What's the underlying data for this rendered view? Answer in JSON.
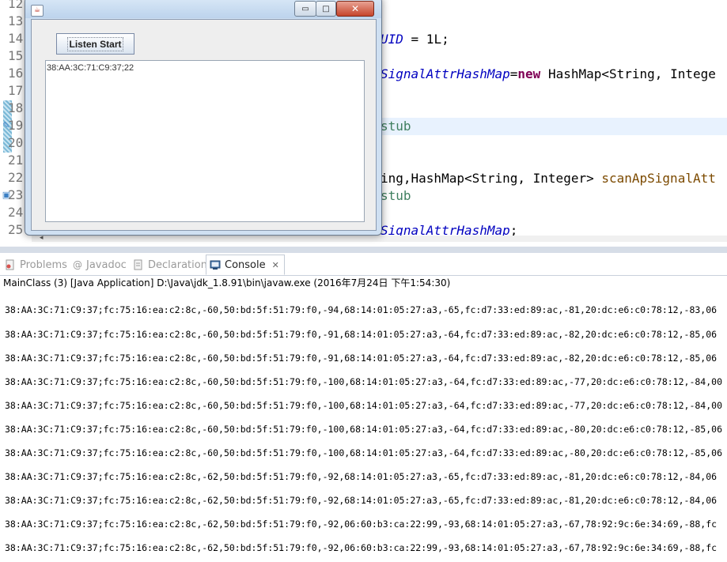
{
  "editor": {
    "line_numbers": [
      "12",
      "13",
      "14",
      "15",
      "16",
      "17",
      "18",
      "19",
      "20",
      "21",
      "22",
      "23",
      "24",
      "25"
    ],
    "code": {
      "line14_fld": "UID",
      "line14_rest": " = 1L;",
      "line16_fld": "SignalAttrHashMap",
      "line16_eq": "=",
      "line16_kw": "new",
      "line16_rest": " HashMap<String, Intege",
      "line19_cmt": "stub",
      "line22_a": "ing,HashMap<String, Integer> ",
      "line22_mth": "scanApSignalAtt",
      "line23_cmt": "stub",
      "line25_fld": "SignalAttrHashMap",
      "line25_rest": ";"
    }
  },
  "tabs": [
    {
      "label": "Problems",
      "icon": "problems-icon"
    },
    {
      "label": "Javadoc",
      "icon": "at-icon"
    },
    {
      "label": "Declaration",
      "icon": "declaration-icon"
    },
    {
      "label": "Console",
      "icon": "console-icon",
      "active": true
    }
  ],
  "console": {
    "header": "MainClass (3) [Java Application] D:\\Java\\jdk_1.8.91\\bin\\javaw.exe (2016年7月24日 下午1:54:30)",
    "lines": [
      "38:AA:3C:71:C9:37;fc:75:16:ea:c2:8c,-60,50:bd:5f:51:79:f0,-94,68:14:01:05:27:a3,-65,fc:d7:33:ed:89:ac,-81,20:dc:e6:c0:78:12,-83,06",
      "38:AA:3C:71:C9:37;fc:75:16:ea:c2:8c,-60,50:bd:5f:51:79:f0,-91,68:14:01:05:27:a3,-64,fc:d7:33:ed:89:ac,-82,20:dc:e6:c0:78:12,-85,06",
      "38:AA:3C:71:C9:37;fc:75:16:ea:c2:8c,-60,50:bd:5f:51:79:f0,-91,68:14:01:05:27:a3,-64,fc:d7:33:ed:89:ac,-82,20:dc:e6:c0:78:12,-85,06",
      "38:AA:3C:71:C9:37;fc:75:16:ea:c2:8c,-60,50:bd:5f:51:79:f0,-100,68:14:01:05:27:a3,-64,fc:d7:33:ed:89:ac,-77,20:dc:e6:c0:78:12,-84,00",
      "38:AA:3C:71:C9:37;fc:75:16:ea:c2:8c,-60,50:bd:5f:51:79:f0,-100,68:14:01:05:27:a3,-64,fc:d7:33:ed:89:ac,-77,20:dc:e6:c0:78:12,-84,00",
      "38:AA:3C:71:C9:37;fc:75:16:ea:c2:8c,-60,50:bd:5f:51:79:f0,-100,68:14:01:05:27:a3,-64,fc:d7:33:ed:89:ac,-80,20:dc:e6:c0:78:12,-85,06",
      "38:AA:3C:71:C9:37;fc:75:16:ea:c2:8c,-60,50:bd:5f:51:79:f0,-100,68:14:01:05:27:a3,-64,fc:d7:33:ed:89:ac,-80,20:dc:e6:c0:78:12,-85,06",
      "38:AA:3C:71:C9:37;fc:75:16:ea:c2:8c,-62,50:bd:5f:51:79:f0,-92,68:14:01:05:27:a3,-65,fc:d7:33:ed:89:ac,-81,20:dc:e6:c0:78:12,-84,06",
      "38:AA:3C:71:C9:37;fc:75:16:ea:c2:8c,-62,50:bd:5f:51:79:f0,-92,68:14:01:05:27:a3,-65,fc:d7:33:ed:89:ac,-81,20:dc:e6:c0:78:12,-84,06",
      "38:AA:3C:71:C9:37;fc:75:16:ea:c2:8c,-62,50:bd:5f:51:79:f0,-92,06:60:b3:ca:22:99,-93,68:14:01:05:27:a3,-67,78:92:9c:6e:34:69,-88,fc",
      "38:AA:3C:71:C9:37;fc:75:16:ea:c2:8c,-62,50:bd:5f:51:79:f0,-92,06:60:b3:ca:22:99,-93,68:14:01:05:27:a3,-67,78:92:9c:6e:34:69,-88,fc"
    ]
  },
  "java_window": {
    "button_label": "Listen Start",
    "text_area_content": "38:AA:3C:71:C9:37;22",
    "minimize_symbol": "▭",
    "maximize_symbol": "□",
    "close_symbol": "✕"
  }
}
